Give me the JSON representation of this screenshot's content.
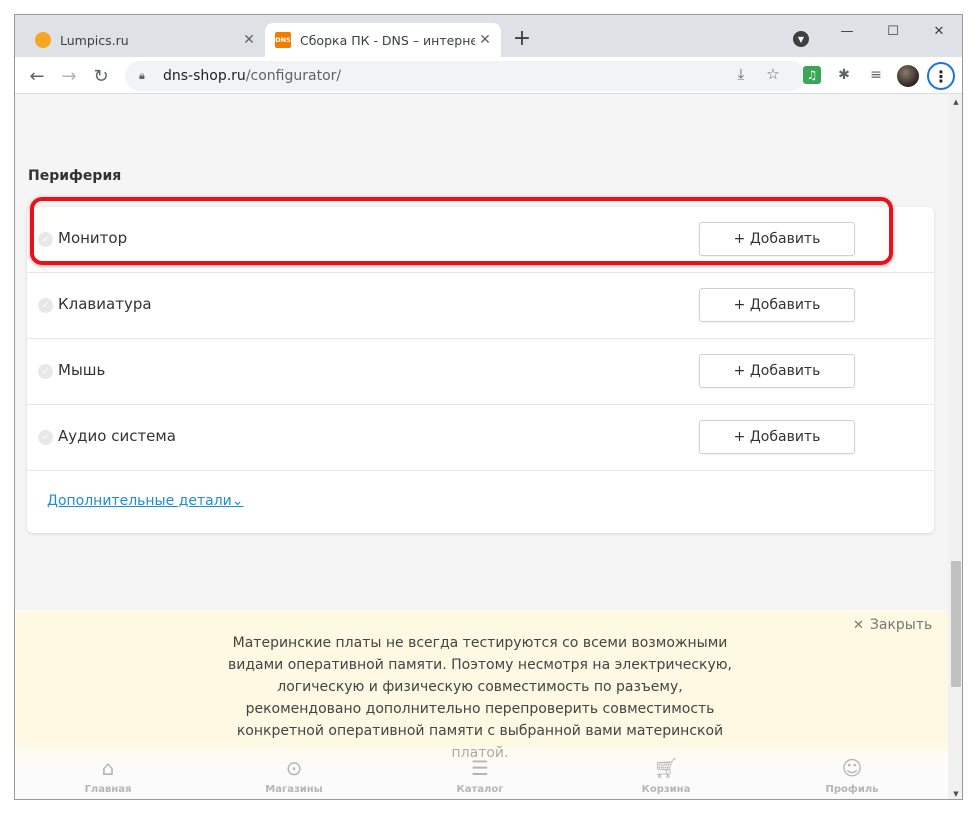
{
  "browser": {
    "tabs": [
      {
        "title": "Lumpics.ru",
        "icon": "lumpics-favicon",
        "active": false
      },
      {
        "title": "Сборка ПК - DNS – интернет ма",
        "icon": "dns-favicon",
        "favicon_text": "DNS",
        "active": true
      }
    ],
    "new_tab_label": "+",
    "url_host": "dns-shop.ru",
    "url_path": "/configurator/"
  },
  "page": {
    "section_title": "Периферия",
    "components": [
      {
        "label": "Монитор",
        "button": "+ Добавить"
      },
      {
        "label": "Клавиатура",
        "button": "+ Добавить"
      },
      {
        "label": "Мышь",
        "button": "+ Добавить"
      },
      {
        "label": "Аудио система",
        "button": "+ Добавить"
      }
    ],
    "more_link": "Дополнительные детали"
  },
  "notice": {
    "close_label": "Закрыть",
    "text": "Материнские платы не всегда тестируются со всеми возможными видами оперативной памяти. Поэтому несмотря на электрическую, логическую и физическую совместимость по разъему, рекомендовано дополнительно перепроверить совместимость конкретной оперативной памяти с выбранной вами материнской платой."
  },
  "bottom_nav": [
    {
      "label": "Главная",
      "icon": "home-icon"
    },
    {
      "label": "Магазины",
      "icon": "map-pin-icon"
    },
    {
      "label": "Каталог",
      "icon": "catalog-search-icon"
    },
    {
      "label": "Корзина",
      "icon": "cart-icon"
    },
    {
      "label": "Профиль",
      "icon": "profile-icon"
    }
  ],
  "colors": {
    "highlight": "#e8121a",
    "link": "#1a8fd6",
    "notice_bg": "#fdf9e3",
    "dns_brand": "#f07d00"
  }
}
